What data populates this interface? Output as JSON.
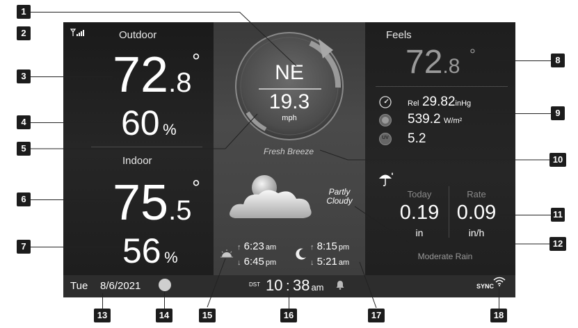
{
  "outdoor": {
    "label": "Outdoor",
    "temp_main": "72",
    "temp_dec": ".8",
    "degree": "°",
    "humidity": "60",
    "humidity_unit": "%"
  },
  "indoor": {
    "label": "Indoor",
    "temp_main": "75",
    "temp_dec": ".5",
    "degree": "°",
    "humidity": "56",
    "humidity_unit": "%"
  },
  "wind": {
    "direction": "NE",
    "speed": "19.3",
    "unit": "mph",
    "description": "Fresh Breeze"
  },
  "forecast": {
    "text_line1": "Partly",
    "text_line2": "Cloudy",
    "icon": "partly-cloudy-icon"
  },
  "sun": {
    "icon": "sunrise-icon",
    "rise_time": "6:23",
    "rise_ampm": "am",
    "set_time": "6:45",
    "set_ampm": "pm",
    "rise_arrow": "↑",
    "set_arrow": "↓"
  },
  "moon": {
    "icon": "moon-icon",
    "rise_time": "8:15",
    "rise_ampm": "pm",
    "set_time": "5:21",
    "set_ampm": "am",
    "rise_arrow": "↑",
    "set_arrow": "↓"
  },
  "feels": {
    "label": "Feels",
    "temp_main": "72",
    "temp_dec": ".8",
    "degree": "°"
  },
  "pressure": {
    "prefix": "Rel",
    "value": "29.82",
    "unit": "inHg",
    "icon": "gauge-icon"
  },
  "solar": {
    "value": "539.2",
    "unit": "W/m²",
    "icon": "sun-icon"
  },
  "uv": {
    "value": "5.2",
    "icon": "uv-icon",
    "icon_text": "UV"
  },
  "rain": {
    "icon": "umbrella-icon",
    "today_label": "Today",
    "today_value": "0.19",
    "today_unit": "in",
    "rate_label": "Rate",
    "rate_value": "0.09",
    "rate_unit": "in/h",
    "description": "Moderate Rain"
  },
  "status": {
    "day": "Tue",
    "date": "8/6/2021",
    "dst": "DST",
    "hour": "10",
    "colon": ":",
    "minute": "38",
    "ampm": "am",
    "sync": "SYNC",
    "signal_icon": "signal-icon",
    "moon_phase_icon": "full-moon-icon",
    "alarm_icon": "bell-icon",
    "wifi_icon": "wifi-icon"
  },
  "callouts": [
    "1",
    "2",
    "3",
    "4",
    "5",
    "6",
    "7",
    "8",
    "9",
    "10",
    "11",
    "12",
    "13",
    "14",
    "15",
    "16",
    "17",
    "18"
  ]
}
